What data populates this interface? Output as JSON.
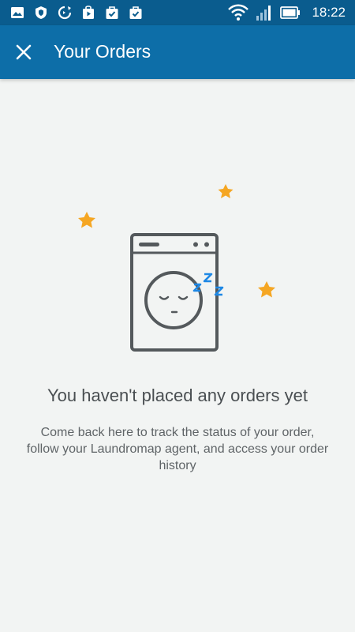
{
  "status_bar": {
    "time": "18:22",
    "left_icons": [
      "gallery-icon",
      "shield-icon",
      "sync-icon",
      "play-store-icon",
      "briefcase-check-icon",
      "briefcase-check-icon"
    ],
    "right_icons": [
      "wifi-icon",
      "signal-icon",
      "battery-icon"
    ]
  },
  "app_bar": {
    "title": "Your Orders",
    "close_icon": "close-icon",
    "color": "#0d6ea8"
  },
  "empty_state": {
    "illustration": "sleeping-washing-machine-icon",
    "title": "You haven't placed any orders yet",
    "description": "Come back here to track the status of your order, follow your Laundromap agent, and access your order history"
  },
  "colors": {
    "status_bar": "#0a5c8e",
    "app_bar": "#0d6ea8",
    "background": "#f2f4f3",
    "star": "#f5a623",
    "zzz": "#1e88e5",
    "machine_outline": "#54595c"
  }
}
